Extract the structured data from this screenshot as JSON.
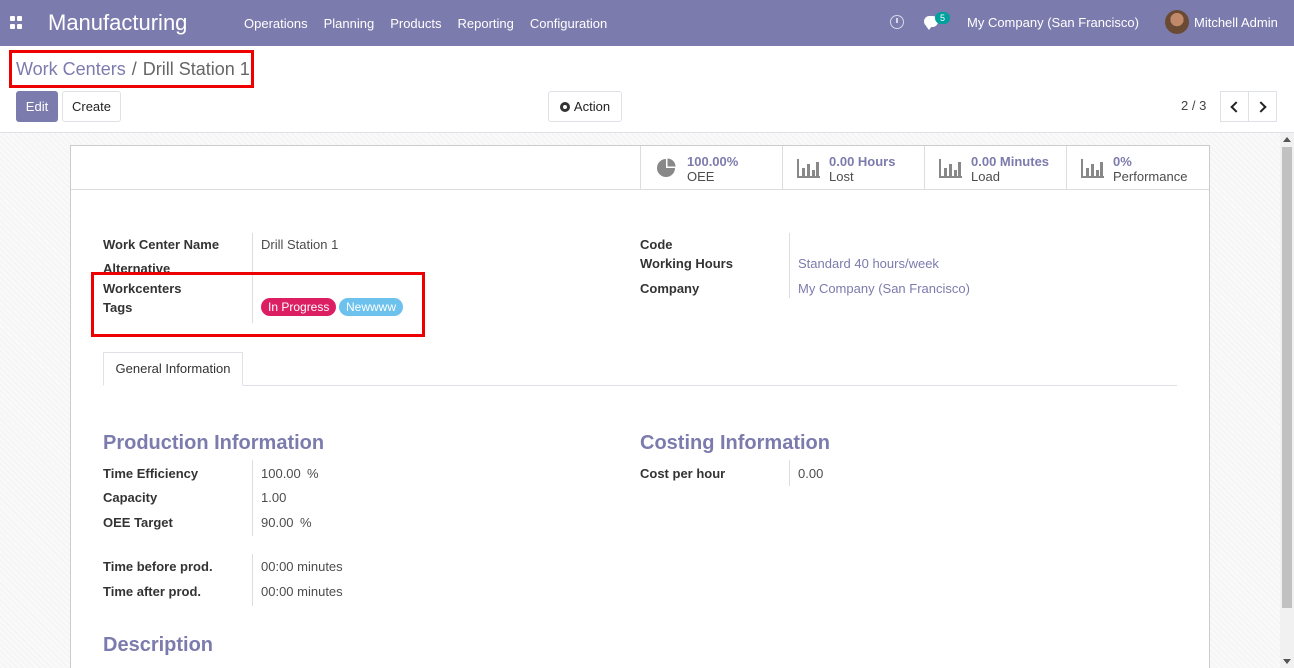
{
  "navbar": {
    "app_title": "Manufacturing",
    "menu": [
      "Operations",
      "Planning",
      "Products",
      "Reporting",
      "Configuration"
    ],
    "chat_count": "5",
    "company": "My Company (San Francisco)",
    "user": "Mitchell Admin"
  },
  "breadcrumb": {
    "parent": "Work Centers",
    "separator": "/",
    "current": "Drill Station 1"
  },
  "buttons": {
    "edit": "Edit",
    "create": "Create",
    "action": "Action"
  },
  "pager": {
    "value": "2 / 3"
  },
  "stats": [
    {
      "value": "100.00%",
      "label": "OEE",
      "icon": "pie-chart-icon"
    },
    {
      "value": "0.00 Hours",
      "label": "Lost",
      "icon": "bar-chart-icon"
    },
    {
      "value": "0.00 Minutes",
      "label": "Load",
      "icon": "bar-chart-icon"
    },
    {
      "value": "0%",
      "label": "Performance",
      "icon": "bar-chart-icon"
    }
  ],
  "fields_left": {
    "name_label": "Work Center Name",
    "name_value": "Drill Station 1",
    "alt_label_1": "Alternative",
    "alt_label_2": "Workcenters",
    "tags_label": "Tags",
    "tags": [
      {
        "label": "In Progress",
        "color": "#dc1f63"
      },
      {
        "label": "Newwww",
        "color": "#6cc1ed"
      }
    ]
  },
  "fields_right": {
    "code_label": "Code",
    "hours_label": "Working Hours",
    "hours_value": "Standard 40 hours/week",
    "company_label": "Company",
    "company_value": "My Company (San Francisco)"
  },
  "tabs": [
    "General Information"
  ],
  "production": {
    "title": "Production Information",
    "time_efficiency_label": "Time Efficiency",
    "time_efficiency_value": "100.00",
    "time_efficiency_unit": "%",
    "capacity_label": "Capacity",
    "capacity_value": "1.00",
    "oee_target_label": "OEE Target",
    "oee_target_value": "90.00",
    "oee_target_unit": "%",
    "time_before_label": "Time before prod.",
    "time_before_value": "00:00 minutes",
    "time_after_label": "Time after prod.",
    "time_after_value": "00:00 minutes"
  },
  "costing": {
    "title": "Costing Information",
    "cost_label": "Cost per hour",
    "cost_value": "0.00"
  },
  "description": {
    "title": "Description"
  },
  "colors": {
    "brand": "#7c7bad",
    "highlight": "#ee0000"
  }
}
